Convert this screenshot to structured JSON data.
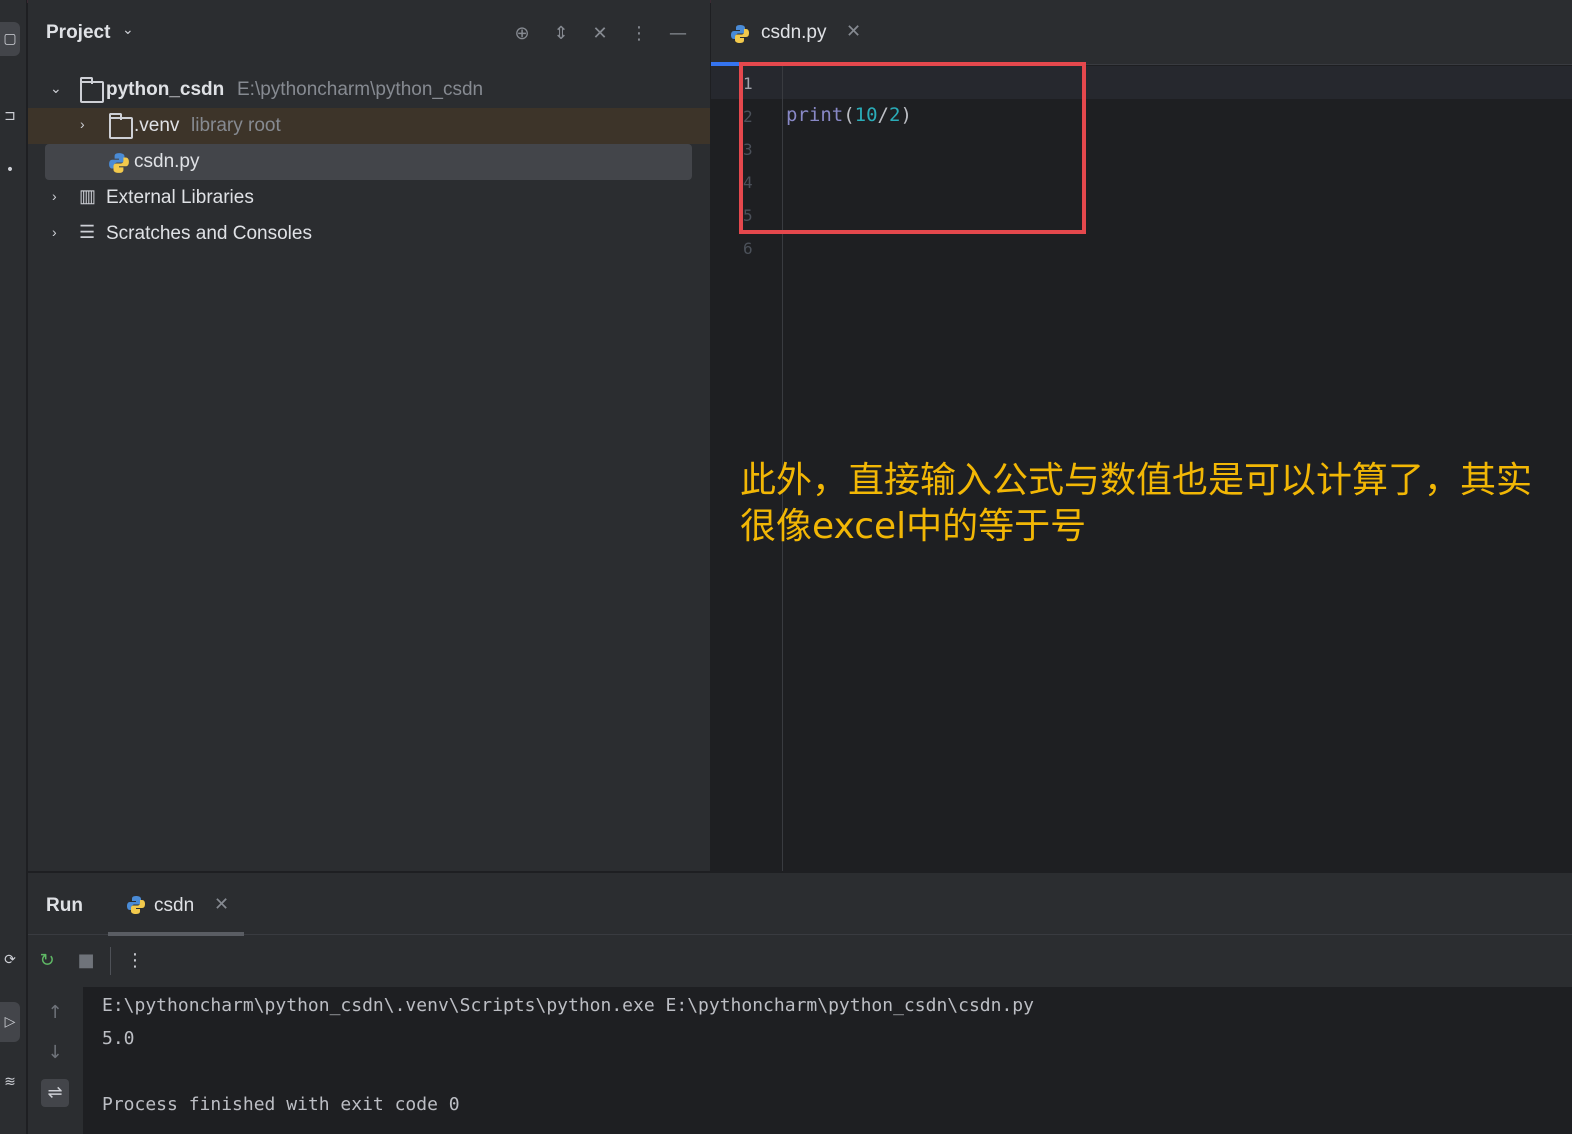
{
  "project_pane": {
    "title": "Project",
    "tree": {
      "root": {
        "name": "python_csdn",
        "path": "E:\\pythoncharm\\python_csdn"
      },
      "venv": {
        "name": ".venv",
        "hint": "library root"
      },
      "file": {
        "name": "csdn.py"
      },
      "external": {
        "name": "External Libraries"
      },
      "scratches": {
        "name": "Scratches and Consoles"
      }
    }
  },
  "editor": {
    "tab_label": "csdn.py",
    "line_numbers": [
      "1",
      "2",
      "3",
      "4",
      "5",
      "6"
    ],
    "code": {
      "fn": "print",
      "open": "(",
      "num1": "10",
      "op": "/",
      "num2": "2",
      "close": ")"
    }
  },
  "annotation": {
    "text": "此外，直接输入公式与数值也是可以计算了，其实很像excel中的等于号",
    "color": "#f2b705"
  },
  "run_panel": {
    "title": "Run",
    "tab_label": "csdn",
    "console": {
      "command": "E:\\pythoncharm\\python_csdn\\.venv\\Scripts\\python.exe E:\\pythoncharm\\python_csdn\\csdn.py",
      "output": "5.0",
      "blank": "",
      "exit": "Process finished with exit code 0"
    }
  },
  "colors": {
    "highlight_box": "#e5484d",
    "accent": "#3574f0"
  },
  "icons": {
    "project_caret": "chevron-down-icon",
    "locate": "crosshair-icon",
    "expand_collapse": "expand-collapse-icon",
    "close_pane": "close-icon",
    "more": "more-vertical-icon",
    "minimize": "minimize-icon",
    "rerun": "rerun-icon",
    "stop": "stop-icon",
    "scroll_up": "arrow-up-icon",
    "scroll_down": "arrow-down-icon",
    "soft_wrap": "soft-wrap-icon"
  }
}
